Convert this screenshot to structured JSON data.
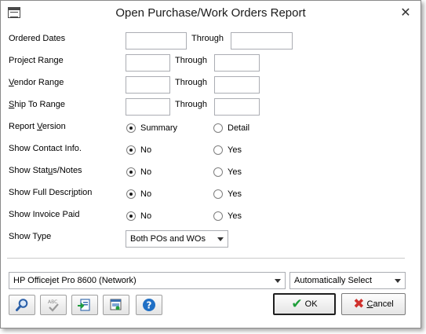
{
  "window": {
    "title": "Open Purchase/Work Orders Report"
  },
  "fields": {
    "ordered_dates": {
      "label": "Ordered Dates",
      "through": "Through"
    },
    "project_range": {
      "label": "Project Range",
      "through": "Through"
    },
    "vendor_range": {
      "label_first": "V",
      "label_rest": "endor Range",
      "through": "Through"
    },
    "ship_to_range": {
      "label_first": "S",
      "label_rest": "hip To Range",
      "through": "Through"
    }
  },
  "options": {
    "report_version": {
      "label_pre": "Report ",
      "label_ul": "V",
      "label_post": "ersion",
      "opt1": "Summary",
      "opt2": "Detail"
    },
    "contact_info": {
      "label": "Show Contact Info.",
      "opt1": "No",
      "opt2": "Yes"
    },
    "status_notes": {
      "label_pre": "Show Stat",
      "label_ul": "u",
      "label_post": "s/Notes",
      "opt1": "No",
      "opt2": "Yes"
    },
    "full_description": {
      "label_pre": "Show Full Descr",
      "label_ul": "i",
      "label_post": "ption",
      "opt1": "No",
      "opt2": "Yes"
    },
    "invoice_paid": {
      "label": "Show Invoice Paid",
      "opt1": "No",
      "opt2": "Yes"
    },
    "show_type": {
      "label": "Show Type",
      "value": "Both POs and WOs"
    }
  },
  "printer": {
    "value": "HP Officejet Pro 8600 (Network)"
  },
  "tray": {
    "value": "Automatically Select"
  },
  "buttons": {
    "ok": "OK",
    "cancel_ul": "C",
    "cancel_rest": "ancel"
  },
  "icons": {
    "title": "window-icon",
    "close": "close-icon",
    "preview": "magnifier-icon",
    "spellcheck": "abc-check-icon",
    "export": "export-icon",
    "printer_setup": "printer-icon",
    "help": "help-icon",
    "ok": "checkmark-icon",
    "cancel": "x-icon"
  },
  "colors": {
    "ok_check": "#1e9e3a",
    "cancel_x": "#d0312d",
    "help_blue": "#1f6fc5",
    "preview_blue": "#2a5fa8"
  }
}
